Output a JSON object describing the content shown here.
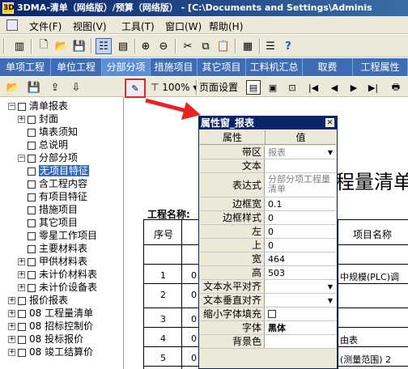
{
  "title": "3DMA-清单（网络版）/预算（网络版） - [C:\\Documents and Settings\\Adminis",
  "menu": [
    {
      "label": "文件(F)"
    },
    {
      "label": "视图(V)"
    },
    {
      "label": "工具(T)"
    },
    {
      "label": "窗口(W)"
    },
    {
      "label": "帮助(H)"
    }
  ],
  "tabs": [
    {
      "label": "单项工程"
    },
    {
      "label": "单位工程"
    },
    {
      "label": "分部分项"
    },
    {
      "label": "措施项目"
    },
    {
      "label": "其它项目"
    },
    {
      "label": "工料机汇总"
    },
    {
      "label": "取费"
    },
    {
      "label": "工程属性"
    }
  ],
  "tree": [
    {
      "label": "清单报表",
      "expander": "−",
      "level": 0
    },
    {
      "label": "封面",
      "expander": "+",
      "level": 1
    },
    {
      "label": "填表须知",
      "expander": "",
      "level": 1
    },
    {
      "label": "总说明",
      "expander": "",
      "level": 1
    },
    {
      "label": "分部分项",
      "expander": "−",
      "level": 1
    },
    {
      "label": "无项目特征",
      "expander": "",
      "level": 2,
      "selected": true
    },
    {
      "label": "含工程内容",
      "expander": "",
      "level": 2
    },
    {
      "label": "有项目特征",
      "expander": "",
      "level": 2
    },
    {
      "label": "措施项目",
      "expander": "",
      "level": 1
    },
    {
      "label": "其它项目",
      "expander": "",
      "level": 1
    },
    {
      "label": "零星工作项目",
      "expander": "",
      "level": 1
    },
    {
      "label": "主要材料表",
      "expander": "",
      "level": 1
    },
    {
      "label": "甲供材料表",
      "expander": "+",
      "level": 1
    },
    {
      "label": "未计价材料表",
      "expander": "+",
      "level": 1
    },
    {
      "label": "未计价设备表",
      "expander": "+",
      "level": 1
    },
    {
      "label": "报价报表",
      "expander": "+",
      "level": 0
    },
    {
      "label": "08 工程量清单",
      "expander": "+",
      "level": 0
    },
    {
      "label": "08 招标控制价",
      "expander": "+",
      "level": 0
    },
    {
      "label": "08 投标报价",
      "expander": "+",
      "level": 0
    },
    {
      "label": "08 竣工结算价",
      "expander": "+",
      "level": 0
    }
  ],
  "report_toolbar": {
    "zoom": "100%",
    "page_setup": "页面设置"
  },
  "report": {
    "title": "程量清单",
    "project_label": "工程名称:",
    "col_seq": "序号",
    "col_item_name": "项目名称",
    "rows": [
      {
        "seq": "1",
        "code": "0",
        "name": "中规模(PLC)调"
      },
      {
        "seq": "2",
        "code": "0",
        "name": ""
      },
      {
        "seq": "3",
        "code": "0",
        "name": ""
      },
      {
        "seq": "4",
        "code": "0",
        "name": "由表"
      },
      {
        "seq": "5",
        "code": "0",
        "name": "(测量范围) 2"
      }
    ]
  },
  "property_window": {
    "title": "属性窗_报表",
    "header_name": "属性",
    "header_value": "值",
    "rows": [
      {
        "name": "带区",
        "value": "报表",
        "gray": true,
        "dropdown": true
      },
      {
        "name": "文本",
        "value": ""
      },
      {
        "name": "表达式",
        "value": "分部分项工程量清单",
        "gray": true
      },
      {
        "name": "边框宽",
        "value": "0.1"
      },
      {
        "name": "边框样式",
        "value": "0"
      },
      {
        "name": "左",
        "value": "0"
      },
      {
        "name": "上",
        "value": "0"
      },
      {
        "name": "宽",
        "value": "464"
      },
      {
        "name": "高",
        "value": "503"
      },
      {
        "name": "文本水平对齐",
        "value": "",
        "dropdown": true
      },
      {
        "name": "文本垂直对齐",
        "value": "",
        "dropdown": true
      },
      {
        "name": "缩小字体填充",
        "value": "",
        "checkbox": true
      },
      {
        "name": "字体",
        "value": "黑体",
        "bold": true
      },
      {
        "name": "背景色",
        "value": ""
      }
    ]
  },
  "colors": {
    "title_bar": "#0a246a",
    "tab_bar": "#3d6db5",
    "selection": "#316ac5",
    "highlight_border": "#ee2222"
  }
}
